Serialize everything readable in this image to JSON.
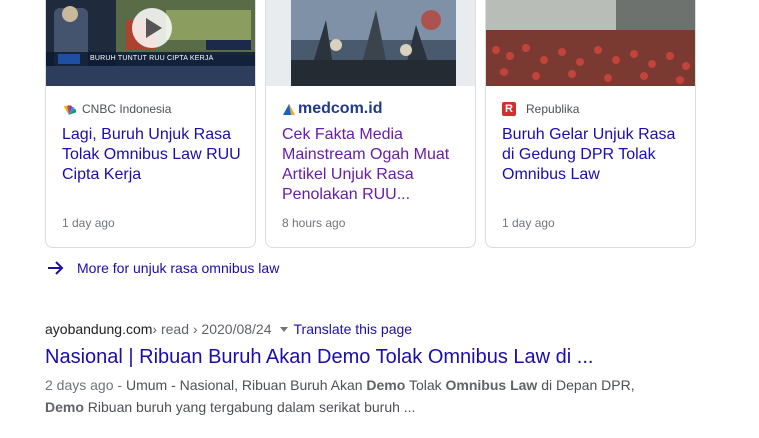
{
  "news_cards": [
    {
      "source": "CNBC Indonesia",
      "title": "Lagi, Buruh Unjuk Rasa Tolak Omnibus Law RUU Cipta Kerja",
      "time": "1 day ago",
      "thumb_caption": "BURUH TUNTUT RUU CIPTA KERJA",
      "visited": false
    },
    {
      "source": "medcom.id",
      "title": "Cek Fakta Media Mainstream Ogah Muat Artikel Unjuk Rasa Penolakan RUU...",
      "time": "8 hours ago",
      "visited": true
    },
    {
      "source": "Republika",
      "title": "Buruh Gelar Unjuk Rasa di Gedung DPR Tolak Omnibus Law",
      "time": "1 day ago",
      "visited": false
    }
  ],
  "more_link": {
    "label": "More for unjuk rasa omnibus law",
    "icon": "arrow-right-icon"
  },
  "result": {
    "domain": "ayobandung.com",
    "path": " › read › 2020/08/24",
    "translate": "Translate this page",
    "title": "Nasional | Ribuan Buruh Akan Demo Tolak Omnibus Law di ...",
    "snippet": {
      "date": "2 days ago",
      "sep": " - ",
      "t1": "Umum - Nasional, Ribuan Buruh Akan ",
      "b1": "Demo",
      "t2": " Tolak ",
      "b2": "Omnibus Law",
      "t3": " di Depan DPR,",
      "b3": "Demo",
      "t4": " Ribuan buruh yang tergabung dalam serikat buruh ..."
    }
  },
  "colors": {
    "link": "#1a0dab",
    "visited": "#681da8",
    "muted": "#70757a",
    "republika_red": "#d32f2f",
    "medcom_blue": "#1565c0"
  }
}
